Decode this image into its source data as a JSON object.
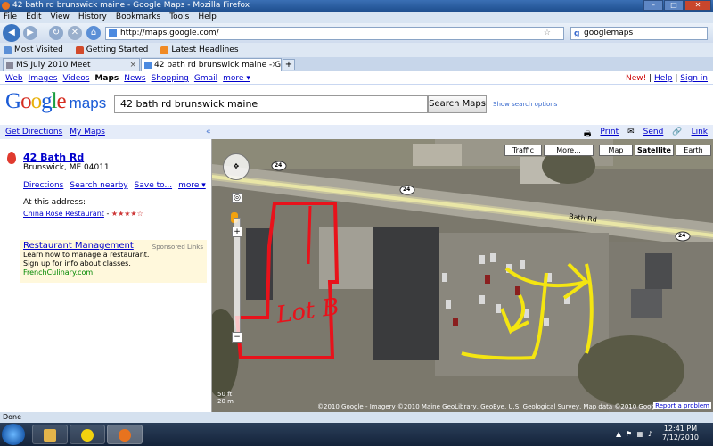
{
  "window": {
    "title": "42 bath rd brunswick maine - Google Maps - Mozilla Firefox"
  },
  "menu": [
    "File",
    "Edit",
    "View",
    "History",
    "Bookmarks",
    "Tools",
    "Help"
  ],
  "nav": {
    "url": "http://maps.google.com/",
    "search_engine_text": "googlemaps"
  },
  "bookmarks": [
    "Most Visited",
    "Getting Started",
    "Latest Headlines"
  ],
  "tabs": [
    {
      "label": "MS July 2010 Meet",
      "active": false
    },
    {
      "label": "42 bath rd brunswick maine - Go...",
      "active": true
    }
  ],
  "gbar": {
    "links": [
      "Web",
      "Images",
      "Videos",
      "Maps",
      "News",
      "Shopping",
      "Gmail",
      "more ▾"
    ],
    "current": "Maps",
    "new_label": "New!",
    "help": "Help",
    "signin": "Sign in"
  },
  "logo": {
    "google": "Google",
    "maps": "maps"
  },
  "search": {
    "query": "42 bath rd brunswick maine",
    "button": "Search Maps",
    "options": "Show search options"
  },
  "toolbar": {
    "get_directions": "Get Directions",
    "my_maps": "My Maps",
    "collapse": "«",
    "print": "Print",
    "send": "Send",
    "link": "Link"
  },
  "result": {
    "title": "42 Bath Rd",
    "address": "Brunswick, ME 04011",
    "links": [
      "Directions",
      "Search nearby",
      "Save to...",
      "more ▾"
    ],
    "at_address_label": "At this address:",
    "restaurant": "China Rose Restaurant",
    "stars": "★★★★☆"
  },
  "ad": {
    "title": "Restaurant Management",
    "sponsored": "Sponsored Links",
    "line1": "Learn how to manage a restaurant.",
    "line2": "Sign up for info about classes.",
    "url": "FrenchCulinary.com"
  },
  "map": {
    "types": [
      "Traffic",
      "More...",
      "Map",
      "Satellite",
      "Earth"
    ],
    "selected_type": "Satellite",
    "road_label": "Bath Rd",
    "route_shield": "24",
    "annotation_text": "Lot B",
    "annotation_color": "#e8121b",
    "arrow_color": "#f4e511",
    "scale_ft": "50 ft",
    "scale_m": "20 m",
    "copyright": "©2010 Google - Imagery ©2010 Maine GeoLibrary, GeoEye, U.S. Geological Survey, Map data ©2010 Google - Terms of Use",
    "report": "Report a problem"
  },
  "status": {
    "text": "Done"
  },
  "taskbar": {
    "time": "12:41 PM",
    "date": "7/12/2010"
  }
}
